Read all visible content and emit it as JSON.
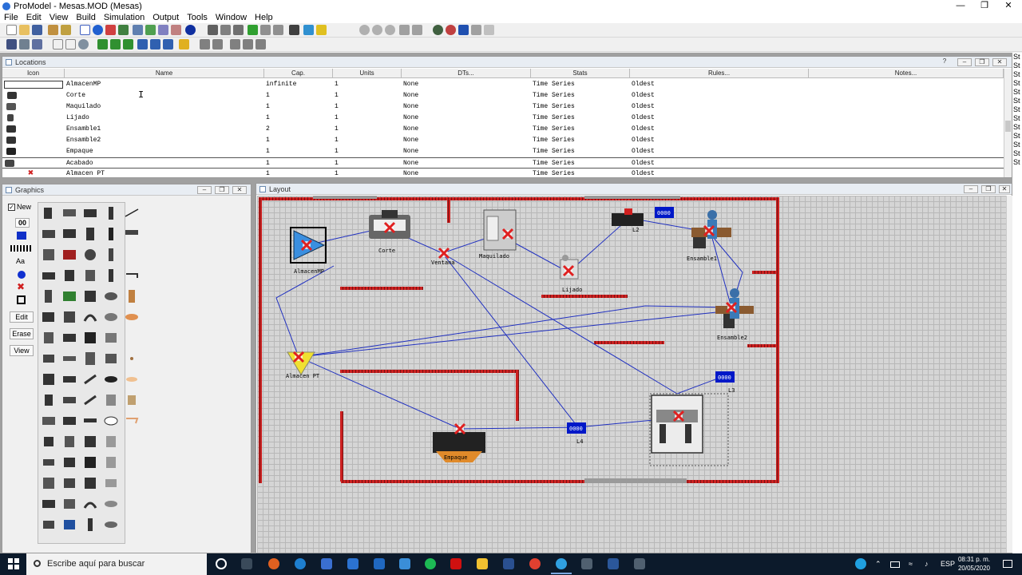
{
  "app": {
    "title": "ProModel - Mesas.MOD (Mesas)"
  },
  "menu": [
    "File",
    "Edit",
    "View",
    "Build",
    "Simulation",
    "Output",
    "Tools",
    "Window",
    "Help"
  ],
  "locations": {
    "title": "Locations",
    "columns": [
      "Icon",
      "Name",
      "Cap.",
      "Units",
      "DTs...",
      "Stats",
      "Rules...",
      "Notes..."
    ],
    "rows": [
      {
        "name": "AlmacenMP",
        "cap": "infinite",
        "units": "1",
        "dts": "None",
        "stats": "Time Series",
        "rules": "Oldest"
      },
      {
        "name": "Corte",
        "cap": "1",
        "units": "1",
        "dts": "None",
        "stats": "Time Series",
        "rules": "Oldest"
      },
      {
        "name": "Maquilado",
        "cap": "1",
        "units": "1",
        "dts": "None",
        "stats": "Time Series",
        "rules": "Oldest"
      },
      {
        "name": "Lijado",
        "cap": "1",
        "units": "1",
        "dts": "None",
        "stats": "Time Series",
        "rules": "Oldest"
      },
      {
        "name": "Ensamble1",
        "cap": "2",
        "units": "1",
        "dts": "None",
        "stats": "Time Series",
        "rules": "Oldest"
      },
      {
        "name": "Ensamble2",
        "cap": "1",
        "units": "1",
        "dts": "None",
        "stats": "Time Series",
        "rules": "Oldest"
      },
      {
        "name": "Empaque",
        "cap": "1",
        "units": "1",
        "dts": "None",
        "stats": "Time Series",
        "rules": "Oldest"
      },
      {
        "name": "Acabado",
        "cap": "1",
        "units": "1",
        "dts": "None",
        "stats": "Time Series",
        "rules": "Oldest"
      },
      {
        "name": "Almacen PT",
        "cap": "1",
        "units": "1",
        "dts": "None",
        "stats": "Time Series",
        "rules": "Oldest"
      }
    ]
  },
  "graphics": {
    "title": "Graphics",
    "new_label": "New",
    "text_tool_label": "Aa",
    "counter_label": "00",
    "edit_label": "Edit",
    "erase_label": "Erase",
    "view_label": "View"
  },
  "layout": {
    "title": "Layout",
    "labels": {
      "almacen_mp": "AlmacenMP",
      "corte": "Corte",
      "ventana": "Ventana",
      "maquilado": "Maquilado",
      "lijado": "Lijado",
      "l2": "L2",
      "ensamble1": "Ensamble1",
      "ensamble2": "Ensamble2",
      "almacen_pt": "Almacen PT",
      "empaque": "Empaque",
      "l4": "L4",
      "l3": "L3",
      "counter": "0000"
    }
  },
  "right_strip": [
    "St",
    "St",
    "St",
    "St",
    "St",
    "St",
    "St",
    "St",
    "St",
    "St",
    "St",
    "St",
    "St"
  ],
  "taskbar": {
    "search_placeholder": "Escribe aquí para buscar",
    "language": "ESP",
    "time": "08:31 p. m.",
    "date": "20/05/2020"
  },
  "colors": {
    "wall": "#cc2020",
    "path": "#2030c0",
    "counter_bg": "#0018c8",
    "taskbar": "#0c1a2b"
  }
}
